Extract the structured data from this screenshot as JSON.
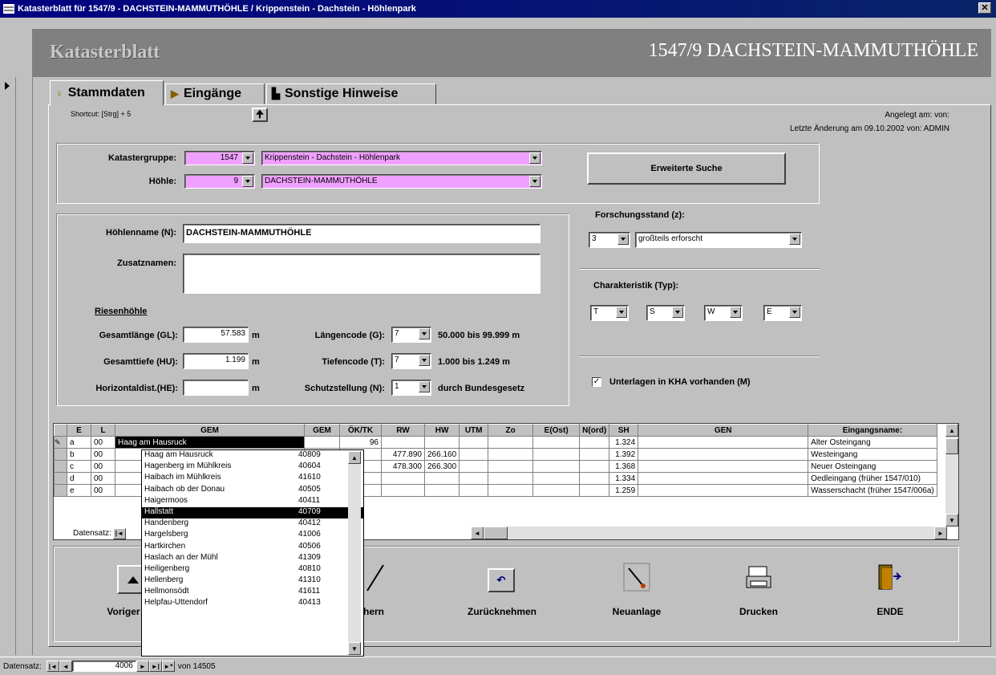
{
  "window": {
    "title": "Katasterblatt für 1547/9 - DACHSTEIN-MAMMUTHÖHLE / Krippenstein - Dachstein - Höhlenpark"
  },
  "header": {
    "left": "Katasterblatt",
    "right": "1547/9 DACHSTEIN-MAMMUTHÖHLE"
  },
  "tabs": [
    "Stammdaten",
    "Eingänge",
    "Sonstige Hinweise"
  ],
  "shortcut": "Shortcut: [Strg] + 5",
  "meta": {
    "angelegt": "Angelegt am: von:",
    "letzte": "Letzte Änderung am 09.10.2002 von: ADMIN"
  },
  "kataster": {
    "gruppe_label": "Katastergruppe:",
    "gruppe_num": "1547",
    "gruppe_name": "Krippenstein - Dachstein - Höhlenpark",
    "hoehle_label": "Höhle:",
    "hoehle_num": "9",
    "hoehle_name": "DACHSTEIN-MAMMUTHÖHLE"
  },
  "erweiterte_suche": "Erweiterte Suche",
  "details": {
    "name_label": "Höhlenname (N):",
    "name": "DACHSTEIN-MAMMUTHÖHLE",
    "zusatz_label": "Zusatznamen:",
    "zusatz": "",
    "riesen": "Riesenhöhle",
    "gl_label": "Gesamtlänge (GL):",
    "gl": "57.583",
    "gl_unit": "m",
    "hu_label": "Gesamttiefe (HU):",
    "hu": "1.199",
    "hu_unit": "m",
    "he_label": "Horizontaldist.(HE):",
    "he": "",
    "he_unit": "m",
    "lc_label": "Längencode (G):",
    "lc": "7",
    "lc_text": "50.000 bis 99.999 m",
    "tc_label": "Tiefencode (T):",
    "tc": "7",
    "tc_text": "1.000 bis 1.249 m",
    "sch_label": "Schutzstellung (N):",
    "sch": "1",
    "sch_text": "durch Bundesgesetz"
  },
  "forschung": {
    "label": "Forschungsstand (z):",
    "num": "3",
    "text": "großteils erforscht"
  },
  "charakt": {
    "label": "Charakteristik (Typ):",
    "vals": [
      "T",
      "S",
      "W",
      "E"
    ]
  },
  "unterlagen": {
    "label": "Unterlagen in KHA vorhanden (M)",
    "mark": "✓"
  },
  "grid": {
    "headers": [
      "E",
      "L",
      "GEM",
      "GEM",
      "ÖK/TK",
      "RW",
      "HW",
      "UTM",
      "Zo",
      "E(Ost)",
      "N(ord)",
      "SH",
      "GEN",
      "Eingangsname:"
    ],
    "rows": [
      [
        "a",
        "00",
        "Haag am Hausruck",
        "",
        "96",
        "",
        "",
        "",
        "",
        "",
        "",
        "1.324",
        "",
        "Alter Osteingang"
      ],
      [
        "b",
        "00",
        "",
        "",
        "",
        "477.890",
        "266.160",
        "",
        "",
        "",
        "",
        "1.392",
        "",
        "Westeingang"
      ],
      [
        "c",
        "00",
        "",
        "",
        "",
        "478.300",
        "266.300",
        "",
        "",
        "",
        "",
        "1.368",
        "",
        "Neuer Osteingang"
      ],
      [
        "d",
        "00",
        "",
        "",
        "",
        "",
        "",
        "",
        "",
        "",
        "",
        "1.334",
        "",
        "Oedleingang (früher 1547/010)"
      ],
      [
        "e",
        "00",
        "",
        "",
        "",
        "",
        "",
        "",
        "",
        "",
        "",
        "1.259",
        "",
        "Wasserschacht (früher 1547/006a)"
      ]
    ],
    "footer": "Datensatz:"
  },
  "popup": [
    [
      "Haag am Hausruck",
      "40809"
    ],
    [
      "Hagenberg im Mühlkreis",
      "40604"
    ],
    [
      "Haibach im Mühlkreis",
      "41610"
    ],
    [
      "Haibach ob der Donau",
      "40505"
    ],
    [
      "Haigermoos",
      "40411"
    ],
    [
      "Hallstatt",
      "40709"
    ],
    [
      "Handenberg",
      "40412"
    ],
    [
      "Hargelsberg",
      "41006"
    ],
    [
      "Hartkirchen",
      "40506"
    ],
    [
      "Haslach an der Mühl",
      "41309"
    ],
    [
      "Heiligenberg",
      "40810"
    ],
    [
      "Hellenberg",
      "41310"
    ],
    [
      "Hellmonsödt",
      "41611"
    ],
    [
      "Helpfau-Uttendorf",
      "40413"
    ]
  ],
  "popup_selected": 5,
  "buttons": [
    "Voriger Satz",
    "Speichern",
    "Zurücknehmen",
    "Neuanlage",
    "Drucken",
    "ENDE"
  ],
  "statusbar": {
    "label": "Datensatz:",
    "record": "4006",
    "of": "von 14505"
  }
}
